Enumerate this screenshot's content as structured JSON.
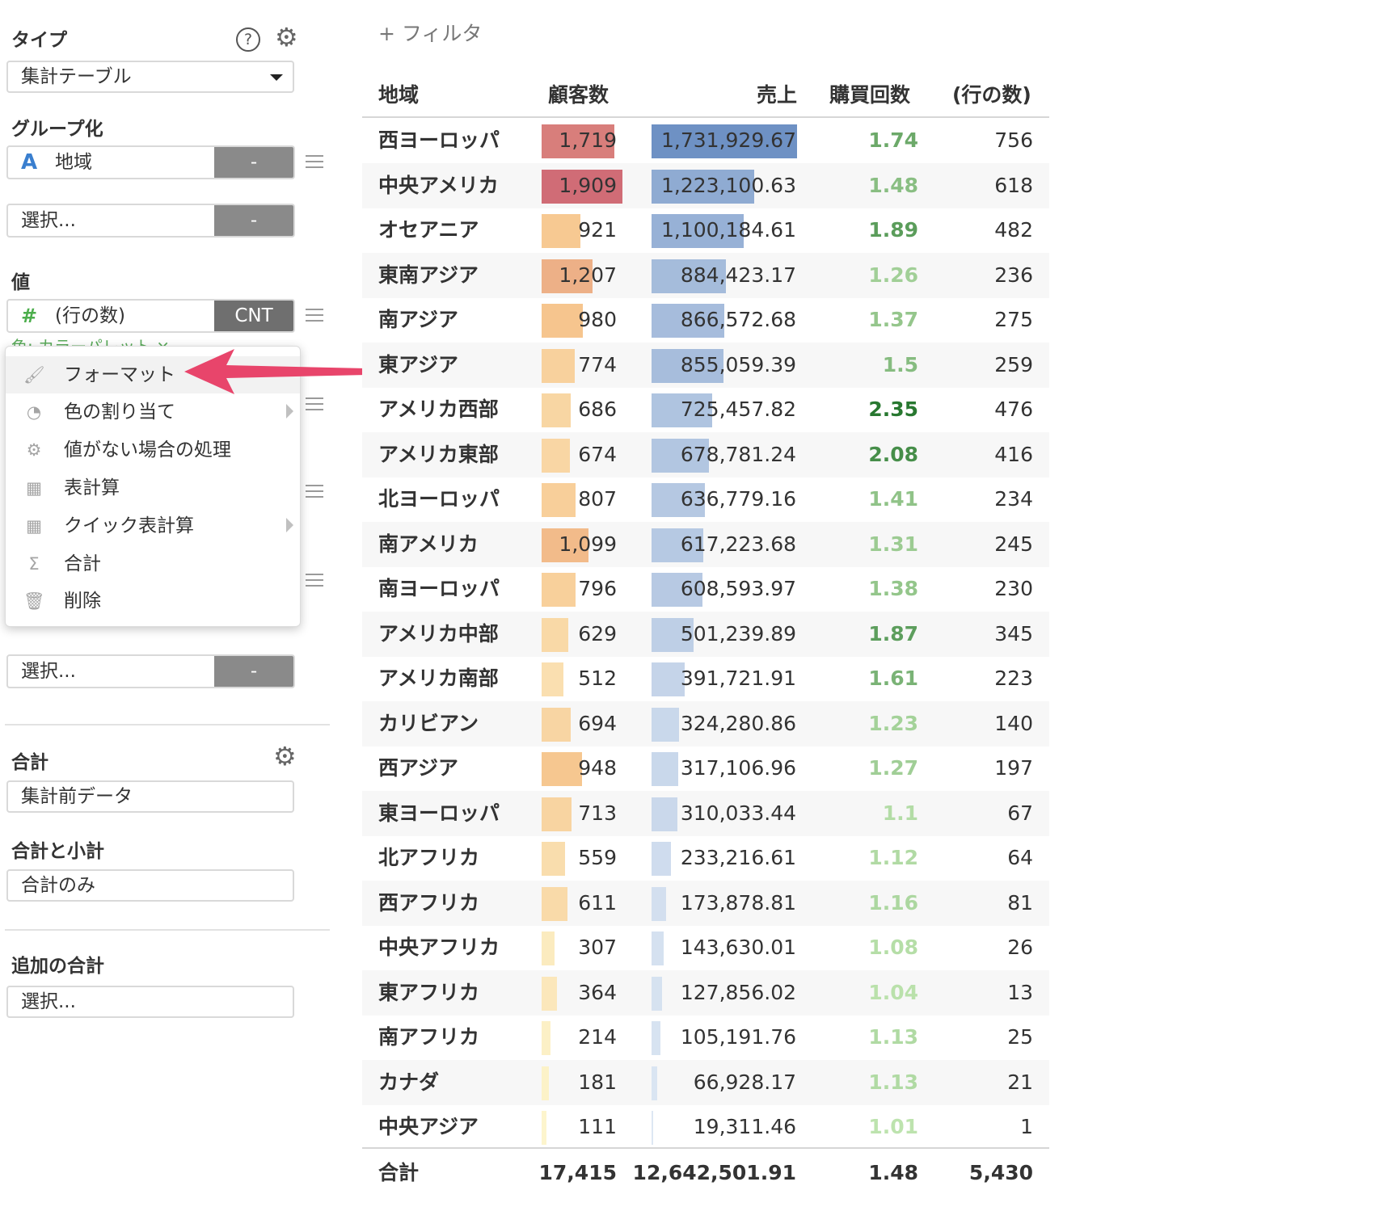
{
  "left": {
    "type_label": "タイプ",
    "type_value": "集計テーブル",
    "group_label": "グループ化",
    "group_field": "地域",
    "group_btn": "-",
    "group_select": "選択...",
    "group_select_btn": "-",
    "value_label": "値",
    "value_field": "(行の数)",
    "value_btn": "CNT",
    "hidden_partial": "色: カラーパレット ×",
    "select2": "選択...",
    "select2_btn": "-",
    "total_label": "合計",
    "total_value": "集計前データ",
    "subtotal_label": "合計と小計",
    "subtotal_value": "合計のみ",
    "extra_label": "追加の合計",
    "extra_value": "選択..."
  },
  "menu": {
    "items": [
      {
        "label": "フォーマット",
        "icon": "brush-icon"
      },
      {
        "label": "色の割り当て",
        "icon": "palette-icon",
        "submenu": true
      },
      {
        "label": "値がない場合の処理",
        "icon": "gear-icon"
      },
      {
        "label": "表計算",
        "icon": "table-icon"
      },
      {
        "label": "クイック表計算",
        "icon": "table-icon",
        "submenu": true
      },
      {
        "label": "合計",
        "icon": "sigma-icon"
      },
      {
        "label": "削除",
        "icon": "trash-icon"
      }
    ]
  },
  "table": {
    "filter": "+ フィルタ",
    "headers": [
      "地域",
      "顧客数",
      "売上▾",
      "購買回数",
      "(行の数)"
    ],
    "rows": [
      {
        "region": "西ヨーロッパ",
        "customers": "1,719",
        "sales": "1,731,929.67",
        "purchases": "1.74",
        "rows": "756"
      },
      {
        "region": "中央アメリカ",
        "customers": "1,909",
        "sales": "1,223,100.63",
        "purchases": "1.48",
        "rows": "618"
      },
      {
        "region": "オセアニア",
        "customers": "921",
        "sales": "1,100,184.61",
        "purchases": "1.89",
        "rows": "482"
      },
      {
        "region": "東南アジア",
        "customers": "1,207",
        "sales": "884,423.17",
        "purchases": "1.26",
        "rows": "236"
      },
      {
        "region": "南アジア",
        "customers": "980",
        "sales": "866,572.68",
        "purchases": "1.37",
        "rows": "275"
      },
      {
        "region": "東アジア",
        "customers": "774",
        "sales": "855,059.39",
        "purchases": "1.5",
        "rows": "259"
      },
      {
        "region": "アメリカ西部",
        "customers": "686",
        "sales": "725,457.82",
        "purchases": "2.35",
        "rows": "476"
      },
      {
        "region": "アメリカ東部",
        "customers": "674",
        "sales": "678,781.24",
        "purchases": "2.08",
        "rows": "416"
      },
      {
        "region": "北ヨーロッパ",
        "customers": "807",
        "sales": "636,779.16",
        "purchases": "1.41",
        "rows": "234"
      },
      {
        "region": "南アメリカ",
        "customers": "1,099",
        "sales": "617,223.68",
        "purchases": "1.31",
        "rows": "245"
      },
      {
        "region": "南ヨーロッパ",
        "customers": "796",
        "sales": "608,593.97",
        "purchases": "1.38",
        "rows": "230"
      },
      {
        "region": "アメリカ中部",
        "customers": "629",
        "sales": "501,239.89",
        "purchases": "1.87",
        "rows": "345"
      },
      {
        "region": "アメリカ南部",
        "customers": "512",
        "sales": "391,721.91",
        "purchases": "1.61",
        "rows": "223"
      },
      {
        "region": "カリビアン",
        "customers": "694",
        "sales": "324,280.86",
        "purchases": "1.23",
        "rows": "140"
      },
      {
        "region": "西アジア",
        "customers": "948",
        "sales": "317,106.96",
        "purchases": "1.27",
        "rows": "197"
      },
      {
        "region": "東ヨーロッパ",
        "customers": "713",
        "sales": "310,033.44",
        "purchases": "1.1",
        "rows": "67"
      },
      {
        "region": "北アフリカ",
        "customers": "559",
        "sales": "233,216.61",
        "purchases": "1.12",
        "rows": "64"
      },
      {
        "region": "西アフリカ",
        "customers": "611",
        "sales": "173,878.81",
        "purchases": "1.16",
        "rows": "81"
      },
      {
        "region": "中央アフリカ",
        "customers": "307",
        "sales": "143,630.01",
        "purchases": "1.08",
        "rows": "26"
      },
      {
        "region": "東アフリカ",
        "customers": "364",
        "sales": "127,856.02",
        "purchases": "1.04",
        "rows": "13"
      },
      {
        "region": "南アフリカ",
        "customers": "214",
        "sales": "105,191.76",
        "purchases": "1.13",
        "rows": "25"
      },
      {
        "region": "カナダ",
        "customers": "181",
        "sales": "66,928.17",
        "purchases": "1.13",
        "rows": "21"
      },
      {
        "region": "中央アジア",
        "customers": "111",
        "sales": "19,311.46",
        "purchases": "1.01",
        "rows": "1"
      }
    ],
    "total": {
      "label": "合計",
      "customers": "17,415",
      "sales": "12,642,501.91",
      "purchases": "1.48",
      "rows": "5,430"
    }
  }
}
